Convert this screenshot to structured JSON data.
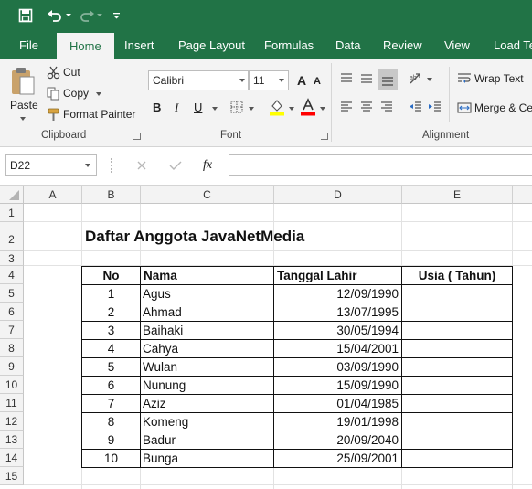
{
  "tabs": [
    "File",
    "Home",
    "Insert",
    "Page Layout",
    "Formulas",
    "Data",
    "Review",
    "View",
    "Load Te"
  ],
  "clipboard": {
    "paste": "Paste",
    "cut": "Cut",
    "copy": "Copy",
    "format_painter": "Format Painter",
    "group": "Clipboard"
  },
  "font": {
    "name": "Calibri",
    "size": "11",
    "bold": "B",
    "italic": "I",
    "underline": "U",
    "group": "Font",
    "fill_color": "#ffff00",
    "font_color": "#ff0000"
  },
  "alignment": {
    "wrap_text": "Wrap Text",
    "merge_center": "Merge & Ce",
    "group": "Alignment"
  },
  "formula_bar": {
    "name_box": "D22",
    "fx": "fx",
    "value": ""
  },
  "columns": [
    "A",
    "B",
    "C",
    "D",
    "E"
  ],
  "rows": [
    "1",
    "2",
    "3",
    "4",
    "5",
    "6",
    "7",
    "8",
    "9",
    "10",
    "11",
    "12",
    "13",
    "14",
    "15"
  ],
  "sheet": {
    "title": "Daftar Anggota JavaNetMedia",
    "headers": [
      "No",
      "Nama",
      "Tanggal Lahir",
      "Usia ( Tahun)"
    ],
    "records": [
      [
        "1",
        "Agus",
        "12/09/1990",
        ""
      ],
      [
        "2",
        "Ahmad",
        "13/07/1995",
        ""
      ],
      [
        "3",
        "Baihaki",
        "30/05/1994",
        ""
      ],
      [
        "4",
        "Cahya",
        "15/04/2001",
        ""
      ],
      [
        "5",
        "Wulan",
        "03/09/1990",
        ""
      ],
      [
        "6",
        "Nunung",
        "15/09/1990",
        ""
      ],
      [
        "7",
        "Aziz",
        "01/04/1985",
        ""
      ],
      [
        "8",
        "Komeng",
        "19/01/1998",
        ""
      ],
      [
        "9",
        "Badur",
        "20/09/2040",
        ""
      ],
      [
        "10",
        "Bunga",
        "25/09/2001",
        ""
      ]
    ]
  },
  "colors": {
    "brand": "#217346"
  }
}
